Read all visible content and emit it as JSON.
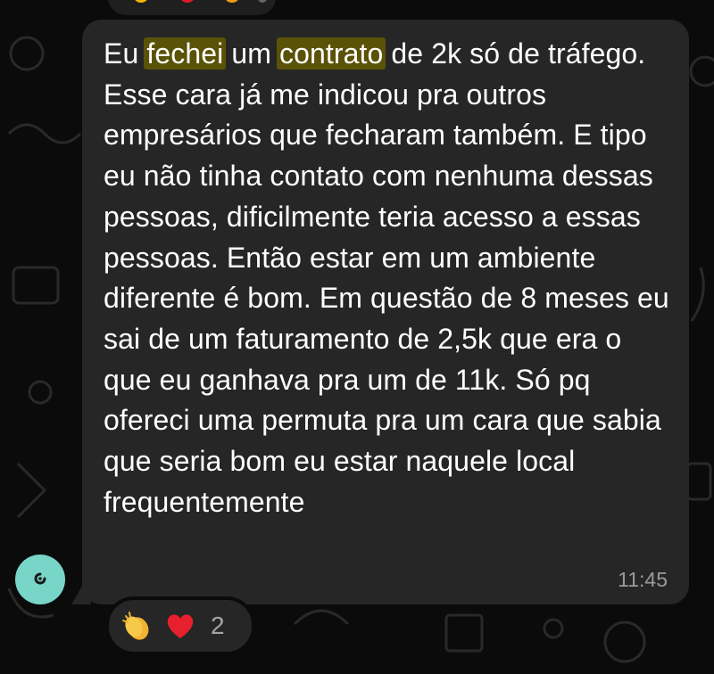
{
  "message": {
    "segments": [
      {
        "text": "Eu ",
        "highlight": false
      },
      {
        "text": "fechei",
        "highlight": true
      },
      {
        "text": " um ",
        "highlight": false
      },
      {
        "text": "contrato",
        "highlight": true
      },
      {
        "text": " de 2k só de tráfego. Esse cara já me indicou pra outros empresários que fecharam também. E tipo eu não tinha contato com nenhuma dessas pessoas, dificilmente teria acesso a essas pessoas. Então estar em um ambiente diferente é bom. Em questão de 8 meses eu sai de um faturamento de 2,5k que era o que eu ganhava pra um de 11k. Só pq ofereci uma permuta pra um cara que sabia que seria bom eu estar naquele local frequentemente",
        "highlight": false
      }
    ],
    "time": "11:45"
  },
  "reactions": {
    "emojis": [
      "clapping-hands-icon",
      "red-heart-icon"
    ],
    "count": "2"
  },
  "colors": {
    "bubble": "#262626",
    "highlight": "#5a5207",
    "avatar": "#77d6c8",
    "background": "#0b0b0b"
  }
}
